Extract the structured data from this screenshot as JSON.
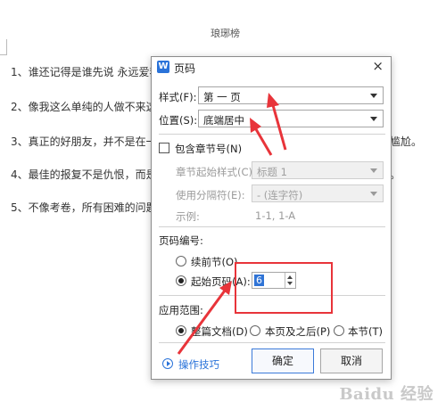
{
  "document": {
    "title": "琅琊榜",
    "lines": [
      {
        "left": "1、谁还记得是谁先说  永远爱我",
        "right": ""
      },
      {
        "left": "2、像我这么单纯的人做不来这",
        "right": ""
      },
      {
        "left": "3、真正的好朋友，并不是在一",
        "right": "剧尴尬。"
      },
      {
        "left": "4、最佳的报复不是仇恨，而是",
        "right": "人。"
      },
      {
        "left": "5、不像考卷，所有困难的问题",
        "right": ""
      }
    ],
    "watermark": "Baidu 经验"
  },
  "dialog": {
    "title": "页码",
    "app_icon": "W",
    "close": "×",
    "style_label": "样式(F):",
    "style_value": "第 一 页",
    "position_label": "位置(S):",
    "position_value": "底端居中",
    "include_chapter": "包含章节号(N)",
    "chapter_style_label": "章节起始样式(C):",
    "chapter_style_value": "标题 1",
    "separator_label": "使用分隔符(E):",
    "separator_value": "-    (连字符)",
    "example_label": "示例:",
    "example_value": "1-1, 1-A",
    "numbering_section": "页码编号:",
    "continue_prev": "续前节(O)",
    "start_page": "起始页码(A):",
    "start_page_value": "6",
    "scope_section": "应用范围:",
    "scope_whole": "整篇文档(D)",
    "scope_this_after": "本页及之后(P)",
    "scope_section_opt": "本节(T)",
    "tips": "操作技巧",
    "ok": "确定",
    "cancel": "取消"
  },
  "colors": {
    "accent": "#2a73d9",
    "annotation": "#e8343a"
  }
}
